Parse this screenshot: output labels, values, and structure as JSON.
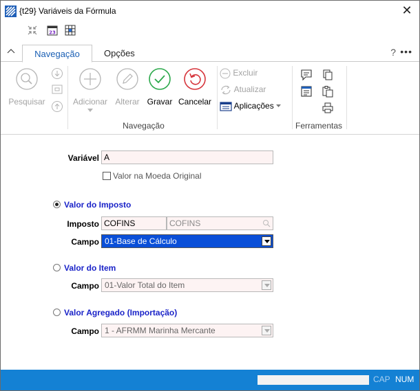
{
  "window": {
    "title": "{t29}  Variáveis da Fórmula",
    "close": "✕"
  },
  "tabs": {
    "navegacao": "Navegação",
    "opcoes": "Opções",
    "help": "?",
    "more": "•••"
  },
  "ribbon": {
    "pesquisar": "Pesquisar",
    "adicionar": "Adicionar",
    "alterar": "Alterar",
    "gravar": "Gravar",
    "cancelar": "Cancelar",
    "excluir": "Excluir",
    "atualizar": "Atualizar",
    "aplicacoes": "Aplicações",
    "group_navegacao": "Navegação",
    "group_ferramentas": "Ferramentas"
  },
  "form": {
    "variavel_label": "Variável",
    "variavel_value": "A",
    "moeda_label": "Valor na Moeda Original",
    "imposto_radio": "Valor do Imposto",
    "imposto_label": "Imposto",
    "imposto_code": "COFINS",
    "imposto_desc": "COFINS",
    "campo_label": "Campo",
    "campo1_value": "01-Base de Cálculo",
    "item_radio": "Valor do Item",
    "campo2_value": "01-Valor Total do Item",
    "agregado_radio": "Valor Agregado (Importação)",
    "campo3_value": "1 - AFRMM Marinha Mercante"
  },
  "status": {
    "cap": "CAP",
    "num": "NUM"
  },
  "colors": {
    "accent": "#1a5fb4",
    "statusbar": "#1481d4",
    "gravar_green": "#2aa84a",
    "cancelar_red": "#d6333a",
    "selection": "#0a4fd8"
  }
}
